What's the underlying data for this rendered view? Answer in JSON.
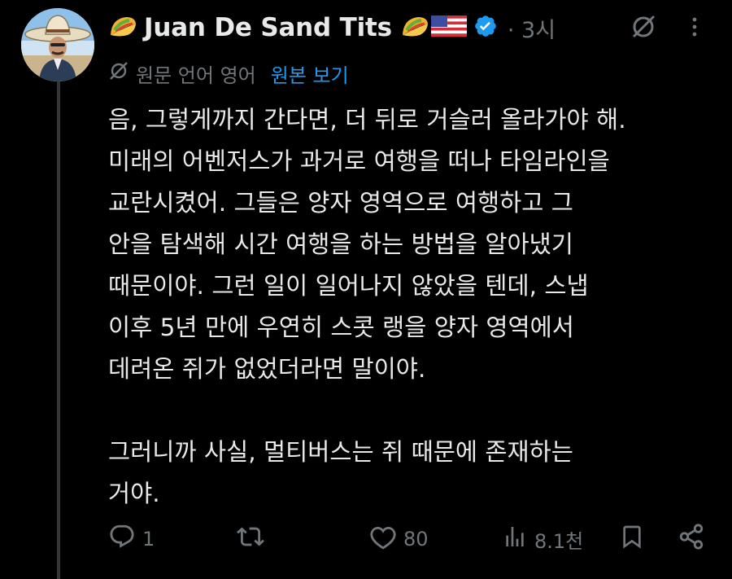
{
  "author": {
    "display_name": "Juan De Sand Tits",
    "avatar_icon": "avatar-man-sombrero",
    "leading_emoji_icon": "taco-icon",
    "trailing_emoji_icons": [
      "taco-icon",
      "us-flag-icon"
    ],
    "verified_icon": "verified-badge-icon",
    "verified_color": "#1d9bf0"
  },
  "timestamp": "· 3시",
  "translation": {
    "label": "원문 언어 영어",
    "view_original": "원본 보기"
  },
  "tweet": {
    "lines": [
      "음, 그렇게까지 간다면, 더 뒤로 거슬러 올라가야 해.",
      "미래의 어벤저스가 과거로 여행을 떠나 타임라인을",
      "교란시켰어. 그들은 양자 영역으로 여행하고 그",
      "안을 탐색해 시간 여행을 하는 방법을 알아냈기",
      "때문이야. 그런 일이 일어나지 않았을 텐데, 스냅",
      "이후 5년 만에 우연히 스콧 랭을 양자 영역에서",
      "데려온 쥐가 없었더라면 말이야."
    ],
    "lines_2": [
      "그러니까 사실, 멀티버스는 쥐 때문에 존재하는",
      "거야."
    ]
  },
  "actions": {
    "replies": "1",
    "reposts": "",
    "likes": "80",
    "views": "8.1천"
  },
  "colors": {
    "background": "#000000",
    "text": "#e7e9ea",
    "muted": "#71767b",
    "accent": "#1d9bf0"
  }
}
